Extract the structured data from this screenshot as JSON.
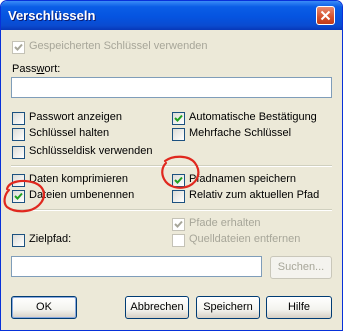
{
  "dialog": {
    "title": "Verschlüsseln"
  },
  "options": {
    "use_saved_key": "Gespeicherten Schlüssel verwenden",
    "password_label": "Passwort:",
    "password_value": "",
    "show_password": "Passwort anzeigen",
    "auto_confirm": "Automatische Bestätigung",
    "hold_key": "Schlüssel halten",
    "multiple_keys": "Mehrfache Schlüssel",
    "use_keydisk": "Schlüsseldisk verwenden",
    "compress_data": "Daten komprimieren",
    "save_pathnames": "Pfadnamen speichern",
    "rename_files": "Dateien umbenennen",
    "relative_path": "Relativ zum aktuellen Pfad",
    "keep_paths": "Pfade erhalten",
    "remove_source": "Quelldateien entfernen",
    "target_path_label": "Zielpfad:",
    "target_path_value": "",
    "search_button": "Suchen..."
  },
  "states": {
    "use_saved_key": true,
    "show_password": false,
    "auto_confirm": true,
    "hold_key": false,
    "multiple_keys": false,
    "use_keydisk": false,
    "compress_data": false,
    "save_pathnames": true,
    "rename_files": true,
    "relative_path": false,
    "keep_paths": true,
    "remove_source": false,
    "target_path": false
  },
  "buttons": {
    "ok": "OK",
    "cancel": "Abbrechen",
    "save": "Speichern",
    "help": "Hilfe"
  },
  "colors": {
    "check": "#21a121",
    "check_disabled": "#a7a699",
    "annotation": "#e0281e"
  }
}
